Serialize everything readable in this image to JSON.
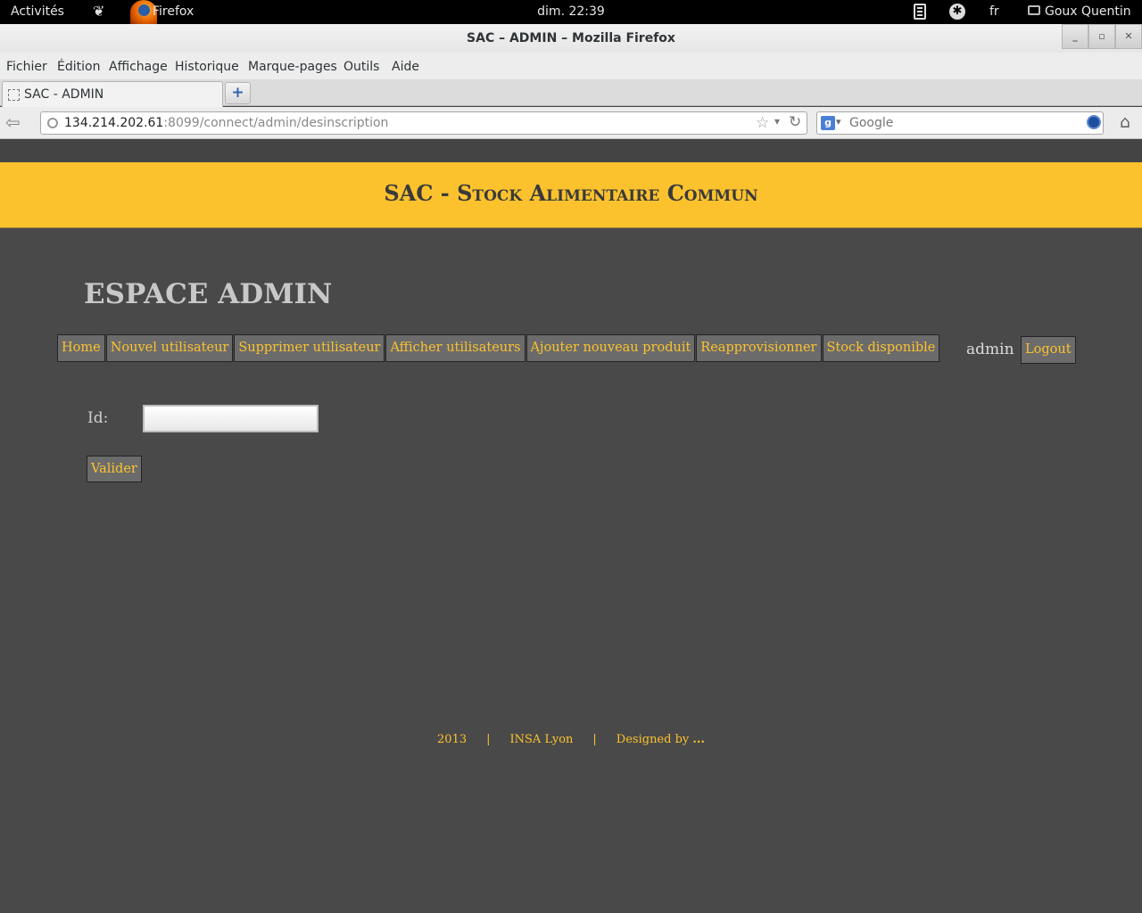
{
  "desktop": {
    "activities": "Activités",
    "app_name": "Firefox",
    "clock": "dim. 22:39",
    "language": "fr",
    "user": "Goux Quentin"
  },
  "window": {
    "title": "SAC – ADMIN – Mozilla Firefox",
    "minimize": "_",
    "maximize": "▫",
    "close": "✕"
  },
  "menubar": {
    "items": [
      "Fichier",
      "Édition",
      "Affichage",
      "Historique",
      "Marque-pages",
      "Outils",
      "Aide"
    ]
  },
  "tabs": {
    "active_label": "SAC - ADMIN",
    "new_tab": "+"
  },
  "navbar": {
    "url_host": "134.214.202.61",
    "url_rest": ":8099/connect/admin/desinscription",
    "search_placeholder": "Google",
    "search_engine_glyph": "g"
  },
  "page": {
    "banner_title": "SAC - Stock Alimentaire Commun",
    "heading": "ESPACE ADMIN",
    "nav": [
      "Home",
      "Nouvel utilisateur",
      "Supprimer utilisateur",
      "Afficher utilisateurs",
      "Ajouter nouveau produit",
      "Reapprovisionner",
      "Stock disponible"
    ],
    "username": "admin",
    "logout": "Logout",
    "form": {
      "id_label": "Id:",
      "id_value": "",
      "submit": "Valider"
    },
    "footer": {
      "year": "2013",
      "separator": "|",
      "org": "INSA Lyon",
      "designed_by": "Designed by",
      "designer": "..."
    },
    "colors": {
      "accent": "#fcc22e",
      "background": "#494949",
      "button": "#6b6b6b"
    }
  }
}
